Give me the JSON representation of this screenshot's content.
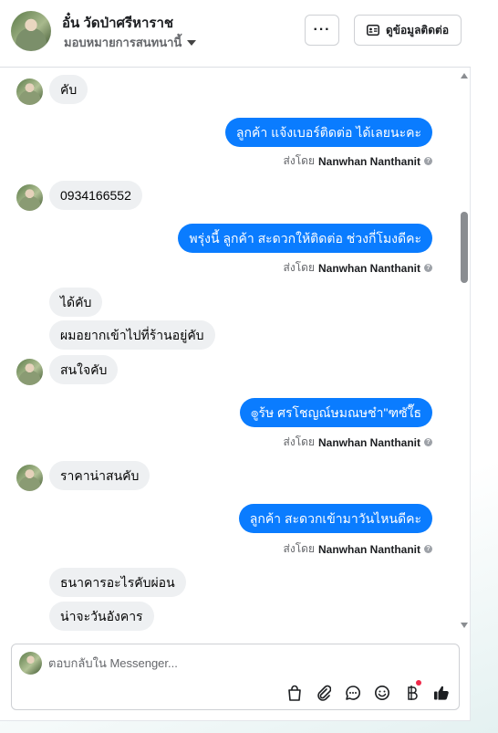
{
  "header": {
    "name": "อั๋น วัดป่าศรีหาราช",
    "subtitle": "มอบหมายการสนทนานี้",
    "more_label": "···",
    "contact_label": "ดูข้อมูลติดต่อ"
  },
  "messages": {
    "m1": "คับ",
    "m2": "ลูกค้า แจ้งเบอร์ติดต่อ ได้เลยนะคะ",
    "m3": "0934166552",
    "m4": "พรุ่งนี้ ลูกค้า สะดวกให้ติดต่อ ช่วงกี่โมงดีคะ",
    "m5": "ได้คับ",
    "m6": "ผมอยากเข้าไปที่ร้านอยู่คับ",
    "m7": "สนใจคับ",
    "m8": "๏ูร้ษ ศรโชญณ์ษมณษช๋า\"ฑซัใ๊ธ",
    "m9": "ราคาน่าสนคับ",
    "m10": "ลูกค้า สะดวกเข้ามาวันไหนดีคะ",
    "m11": "ธนาคารอะไรคับผ่อน",
    "m12": "น่าจะวันอังคาร"
  },
  "sent_by": {
    "prefix": "ส่งโดย",
    "name": "Nanwhan Nanthanit"
  },
  "composer": {
    "placeholder": "ตอบกลับใน Messenger..."
  },
  "icons": [
    "shopping-bag-icon",
    "paperclip-icon",
    "chat-bubble-icon",
    "emoji-icon",
    "baht-icon",
    "thumbs-up-icon"
  ],
  "colors": {
    "accent": "#0a7cff",
    "incoming_bubble": "#eef0f2",
    "like": "#1c1e21"
  }
}
